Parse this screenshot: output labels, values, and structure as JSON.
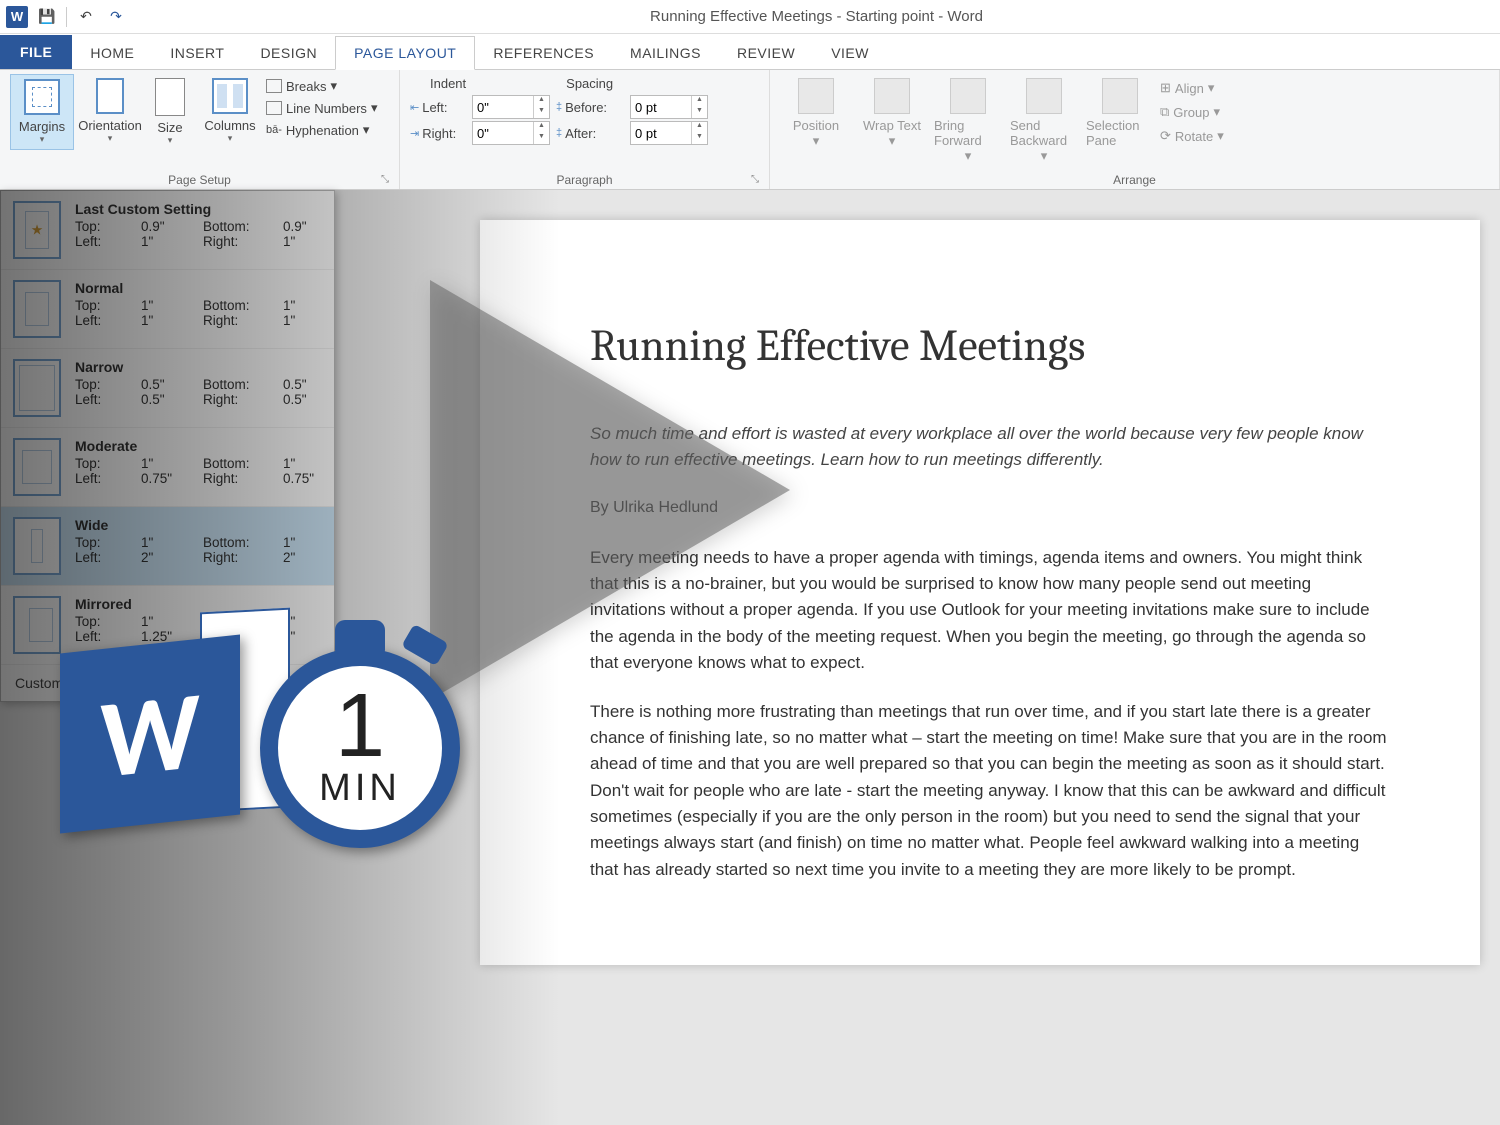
{
  "titlebar": {
    "title": "Running Effective Meetings - Starting point - Word"
  },
  "tabs": [
    "FILE",
    "HOME",
    "INSERT",
    "DESIGN",
    "PAGE LAYOUT",
    "REFERENCES",
    "MAILINGS",
    "REVIEW",
    "VIEW"
  ],
  "active_tab": "PAGE LAYOUT",
  "ribbon": {
    "page_setup": {
      "margins": "Margins",
      "orientation": "Orientation",
      "size": "Size",
      "columns": "Columns",
      "breaks": "Breaks",
      "line_numbers": "Line Numbers",
      "hyphenation": "Hyphenation",
      "label": "Page Setup"
    },
    "paragraph": {
      "indent_label": "Indent",
      "spacing_label": "Spacing",
      "left_label": "Left:",
      "left_val": "0\"",
      "right_label": "Right:",
      "right_val": "0\"",
      "before_label": "Before:",
      "before_val": "0 pt",
      "after_label": "After:",
      "after_val": "0 pt",
      "label": "Paragraph"
    },
    "arrange": {
      "position": "Position",
      "wrap": "Wrap Text",
      "bring": "Bring Forward",
      "send": "Send Backward",
      "selection": "Selection Pane",
      "align": "Align",
      "group": "Group",
      "rotate": "Rotate",
      "label": "Arrange"
    }
  },
  "margins_menu": {
    "items": [
      {
        "title": "Last Custom Setting",
        "top": "0.9\"",
        "bottom": "0.9\"",
        "left": "1\"",
        "right": "1\"",
        "cls": "last"
      },
      {
        "title": "Normal",
        "top": "1\"",
        "bottom": "1\"",
        "left": "1\"",
        "right": "1\"",
        "cls": "normal"
      },
      {
        "title": "Narrow",
        "top": "0.5\"",
        "bottom": "0.5\"",
        "left": "0.5\"",
        "right": "0.5\"",
        "cls": "narrow"
      },
      {
        "title": "Moderate",
        "top": "1\"",
        "bottom": "1\"",
        "left": "0.75\"",
        "right": "0.75\"",
        "cls": "moderate"
      },
      {
        "title": "Wide",
        "top": "1\"",
        "bottom": "1\"",
        "left": "2\"",
        "right": "2\"",
        "cls": "wide"
      },
      {
        "title": "Mirrored",
        "top": "1\"",
        "bottom": "1\"",
        "left": "1.25\"",
        "right": "1\"",
        "cls": "mirrored"
      }
    ],
    "labels": {
      "top": "Top:",
      "bottom": "Bottom:",
      "left": "Left:",
      "right": "Right:"
    },
    "custom": "Custom Margins...",
    "hover_index": 4
  },
  "document": {
    "heading": "Running Effective Meetings",
    "intro": "So much time and effort is wasted at every workplace all over the world because very few people know how to run effective meetings. Learn how to run meetings differently.",
    "byline": "By Ulrika Hedlund",
    "p1": "Every meeting needs to have a proper agenda with timings, agenda items and owners. You might think that this is a no-brainer, but you would be surprised to know how many people send out meeting invitations without a proper agenda. If you use Outlook for your meeting invitations make sure to include the agenda in the body of the meeting request. When you begin the meeting, go through the agenda so that everyone knows what to expect.",
    "p2": "There is nothing more frustrating than meetings that run over time, and if you start late there is a greater chance of finishing late, so no matter what – start the meeting on time! Make sure that you are in the room ahead of time and that you are well prepared so that you can begin the meeting as soon as it should start. Don't wait for people who are late - start the meeting anyway. I know that this can be awkward and difficult sometimes (especially if you are the only person in the room) but you need to send the signal that your meetings always start (and finish) on time no matter what. People feel awkward walking into a meeting that has already started so next time you invite to a meeting they are more likely to be prompt."
  },
  "badge": {
    "w": "W",
    "num": "1",
    "min": "MIN"
  }
}
